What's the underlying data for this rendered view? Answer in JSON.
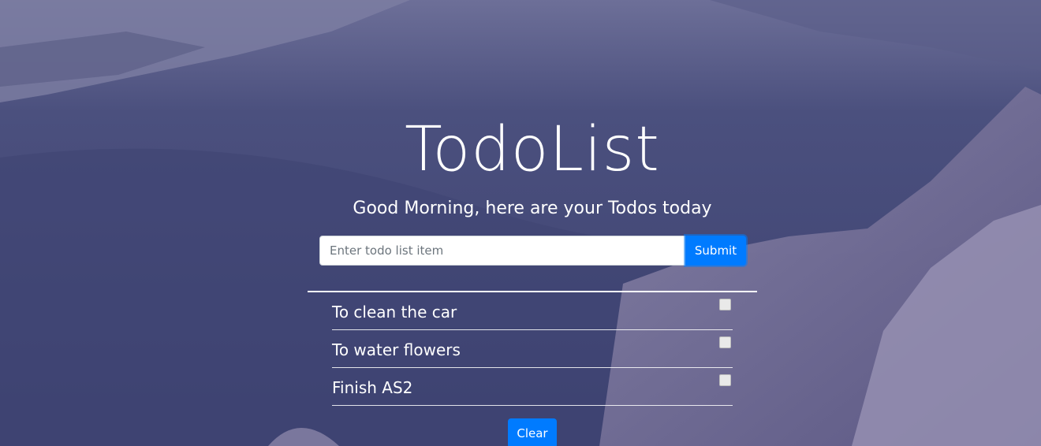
{
  "header": {
    "title": "TodoList",
    "subtitle": "Good Morning, here are your Todos today"
  },
  "form": {
    "placeholder": "Enter todo list item",
    "value": "",
    "submit_label": "Submit"
  },
  "todos": [
    {
      "text": "To clean the car",
      "checked": false
    },
    {
      "text": "To water flowers",
      "checked": false
    },
    {
      "text": "Finish AS2",
      "checked": false
    }
  ],
  "clear_label": "Clear",
  "colors": {
    "overlay": "#4a4f7c",
    "accent": "#007bff",
    "text": "#ffffff"
  }
}
